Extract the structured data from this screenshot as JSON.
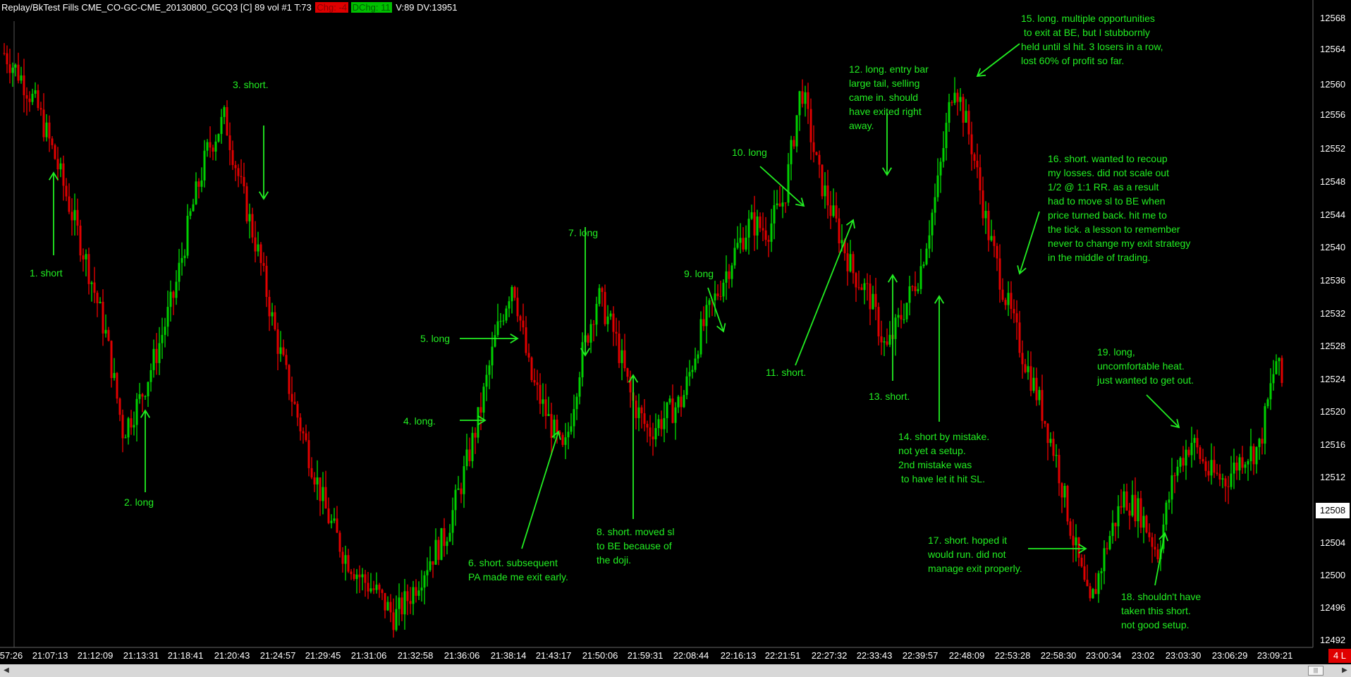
{
  "window": {
    "title_prefix": "Replay/BkTest Fills  CME_CO-GC-CME_20130800_GCQ3 [C]  89 vol  #1 T:73",
    "chg_label": "Chg: -4",
    "dchg_label": "DChg: 11",
    "title_suffix": "V:89 DV:13951"
  },
  "colors": {
    "up_bar": "#00d000",
    "down_bar": "#e00000",
    "annotation": "#22ee22",
    "background": "#000000"
  },
  "annotations": [
    {
      "text": "1. short"
    },
    {
      "text": "2. long"
    },
    {
      "text": "3. short."
    },
    {
      "text": "4. long."
    },
    {
      "text": "5. long"
    },
    {
      "text": "6. short. subsequent\nPA made me exit early."
    },
    {
      "text": "7. long"
    },
    {
      "text": "8. short. moved sl\nto BE because of\nthe doji."
    },
    {
      "text": "9. long"
    },
    {
      "text": "10. long"
    },
    {
      "text": "11. short."
    },
    {
      "text": "12. long. entry bar\nlarge tail, selling\ncame in. should\nhave exited right\naway."
    },
    {
      "text": "13. short."
    },
    {
      "text": "14. short by mistake.\nnot yet a setup.\n2nd mistake was\n to have let it hit SL."
    },
    {
      "text": "15. long. multiple opportunities\n to exit at BE, but I stubbornly\nheld until sl hit. 3 losers in a row,\nlost 60% of profit so far."
    },
    {
      "text": "16. short. wanted to recoup\nmy losses. did not scale out\n1/2 @ 1:1 RR. as a result\nhad to move sl to BE when\nprice turned back. hit me to\nthe tick. a lesson to remember\nnever to change my exit strategy\nin the middle of trading."
    },
    {
      "text": "17. short. hoped it\nwould run. did not\nmanage exit properly."
    },
    {
      "text": "18. shouldn't have\ntaken this short.\nnot good setup."
    },
    {
      "text": "19. long,\nuncomfortable heat.\njust wanted to get out."
    }
  ],
  "price_axis": [
    "12568",
    "12564",
    "12560",
    "12556",
    "12552",
    "12548",
    "12544",
    "12540",
    "12536",
    "12532",
    "12528",
    "12524",
    "12520",
    "12516",
    "12512",
    "12504",
    "12500",
    "12496",
    "12492"
  ],
  "current_price": "12508",
  "time_axis": [
    "57:26",
    "21:07:13",
    "21:12:09",
    "21:13:31",
    "21:18:41",
    "21:20:43",
    "21:24:57",
    "21:29:45",
    "21:31:06",
    "21:32:58",
    "21:36:06",
    "21:38:14",
    "21:43:17",
    "21:50:06",
    "21:59:31",
    "22:08:44",
    "22:16:13",
    "22:21:51",
    "22:27:32",
    "22:33:43",
    "22:39:57",
    "22:48:09",
    "22:53:28",
    "22:58:30",
    "23:00:34",
    "23:02",
    "23:03:30",
    "23:06:29",
    "23:09:21"
  ],
  "lots_badge": "4 L",
  "price_path": [
    [
      0,
      12565
    ],
    [
      1,
      12562
    ],
    [
      2,
      12558
    ],
    [
      3,
      12552
    ],
    [
      4,
      12545
    ],
    [
      5,
      12538
    ],
    [
      6,
      12530
    ],
    [
      7,
      12518
    ],
    [
      8,
      12522
    ],
    [
      9,
      12528
    ],
    [
      10,
      12535
    ],
    [
      11,
      12545
    ],
    [
      12,
      12553
    ],
    [
      13,
      12557
    ],
    [
      14,
      12548
    ],
    [
      15,
      12540
    ],
    [
      16,
      12530
    ],
    [
      17,
      12522
    ],
    [
      18,
      12515
    ],
    [
      19,
      12508
    ],
    [
      20,
      12503
    ],
    [
      21,
      12500
    ],
    [
      22,
      12498
    ],
    [
      23,
      12495
    ],
    [
      24,
      12498
    ],
    [
      25,
      12502
    ],
    [
      26,
      12505
    ],
    [
      27,
      12512
    ],
    [
      28,
      12520
    ],
    [
      29,
      12530
    ],
    [
      30,
      12537
    ],
    [
      31,
      12525
    ],
    [
      32,
      12520
    ],
    [
      33,
      12515
    ],
    [
      34,
      12527
    ],
    [
      35,
      12535
    ],
    [
      36,
      12530
    ],
    [
      37,
      12522
    ],
    [
      38,
      12518
    ],
    [
      39,
      12520
    ],
    [
      40,
      12522
    ],
    [
      41,
      12530
    ],
    [
      42,
      12535
    ],
    [
      43,
      12540
    ],
    [
      44,
      12544
    ],
    [
      45,
      12543
    ],
    [
      46,
      12547
    ],
    [
      47,
      12561
    ],
    [
      48,
      12550
    ],
    [
      49,
      12544
    ],
    [
      50,
      12538
    ],
    [
      51,
      12535
    ],
    [
      52,
      12528
    ],
    [
      53,
      12533
    ],
    [
      54,
      12538
    ],
    [
      55,
      12548
    ],
    [
      56,
      12562
    ],
    [
      57,
      12554
    ],
    [
      58,
      12543
    ],
    [
      59,
      12535
    ],
    [
      60,
      12528
    ],
    [
      61,
      12522
    ],
    [
      62,
      12515
    ],
    [
      63,
      12505
    ],
    [
      64,
      12496
    ],
    [
      65,
      12504
    ],
    [
      66,
      12510
    ],
    [
      67,
      12508
    ],
    [
      68,
      12503
    ],
    [
      69,
      12513
    ],
    [
      70,
      12517
    ],
    [
      71,
      12513
    ],
    [
      72,
      12512
    ],
    [
      73,
      12515
    ],
    [
      74,
      12516
    ],
    [
      75,
      12527
    ],
    [
      76,
      12518
    ],
    [
      77,
      12512
    ]
  ]
}
